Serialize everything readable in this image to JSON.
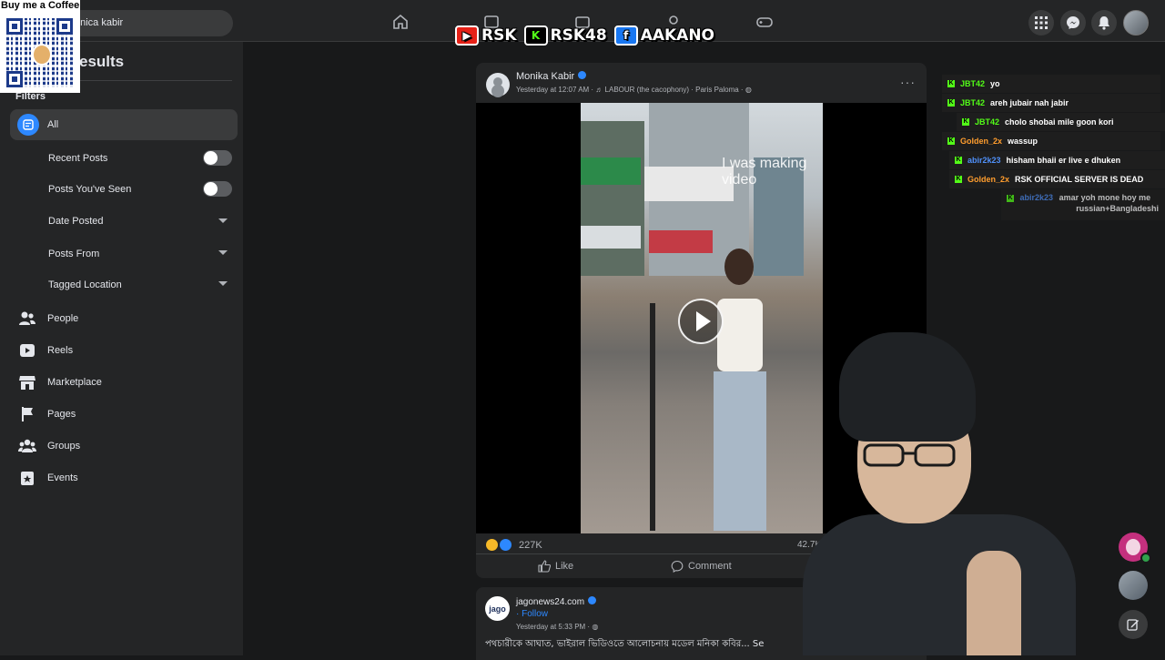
{
  "overlay": {
    "coffee_title": "Buy me a Coffee",
    "badges": [
      {
        "icon": "youtube-icon",
        "label": "RSK",
        "color": "#e62117"
      },
      {
        "icon": "kick-icon",
        "label": "RSK48",
        "color": "#53fc18"
      },
      {
        "icon": "facebook-icon",
        "label": "AAKANO",
        "color": "#1877f2"
      }
    ]
  },
  "search": {
    "value": "onica kabir"
  },
  "sidebar": {
    "title": "esults",
    "filters_label": "Filters",
    "filter_all": "All",
    "sub_filters": [
      {
        "label": "Recent Posts",
        "type": "toggle"
      },
      {
        "label": "Posts You've Seen",
        "type": "toggle"
      },
      {
        "label": "Date Posted",
        "type": "dropdown"
      },
      {
        "label": "Posts From",
        "type": "dropdown"
      },
      {
        "label": "Tagged Location",
        "type": "dropdown"
      }
    ],
    "categories": [
      {
        "label": "People",
        "icon": "people-icon"
      },
      {
        "label": "Reels",
        "icon": "reels-icon"
      },
      {
        "label": "Marketplace",
        "icon": "marketplace-icon"
      },
      {
        "label": "Pages",
        "icon": "flag-icon"
      },
      {
        "label": "Groups",
        "icon": "groups-icon"
      },
      {
        "label": "Events",
        "icon": "events-icon"
      }
    ]
  },
  "post": {
    "author": "Monika Kabir",
    "meta": "Yesterday at 12:07 AM · ♬ LABOUR (the cacophony) · Paris Paloma · ",
    "video_caption": "I was making video",
    "reaction_count": "227K",
    "comment_count": "42.7K",
    "actions": {
      "like": "Like",
      "comment": "Comment"
    }
  },
  "post2": {
    "avatar_text": "jago",
    "author": "jagonews24.com",
    "follow": "· Follow",
    "meta": "Yesterday at 5:33 PM · ",
    "text": "পথচারীকে আঘাত, ভাইরাল ভিডিওতে আলোচনায় মডেল মনিকা কবির... Se"
  },
  "chat": [
    {
      "user": "JBT42",
      "message": "yo",
      "user_color": "#53fc18"
    },
    {
      "user": "JBT42",
      "message": "areh jubair nah jabir",
      "user_color": "#53fc18"
    },
    {
      "user": "JBT42",
      "message": "cholo shobai mile goon kori",
      "user_color": "#53fc18"
    },
    {
      "user": "Golden_2x",
      "message": "wassup",
      "user_color": "#ff9d2e"
    },
    {
      "user": "abir2k23",
      "message": "hisham bhaii er live e dhuken",
      "user_color": "#4f8ff7"
    },
    {
      "user": "Golden_2x",
      "message": "RSK OFFICIAL SERVER IS DEAD",
      "user_color": "#ff9d2e"
    },
    {
      "user": "abir2k23",
      "message": "amar yoh mone hoy me",
      "message2": "russian+Bangladeshi",
      "user_color": "#4f8ff7"
    }
  ]
}
